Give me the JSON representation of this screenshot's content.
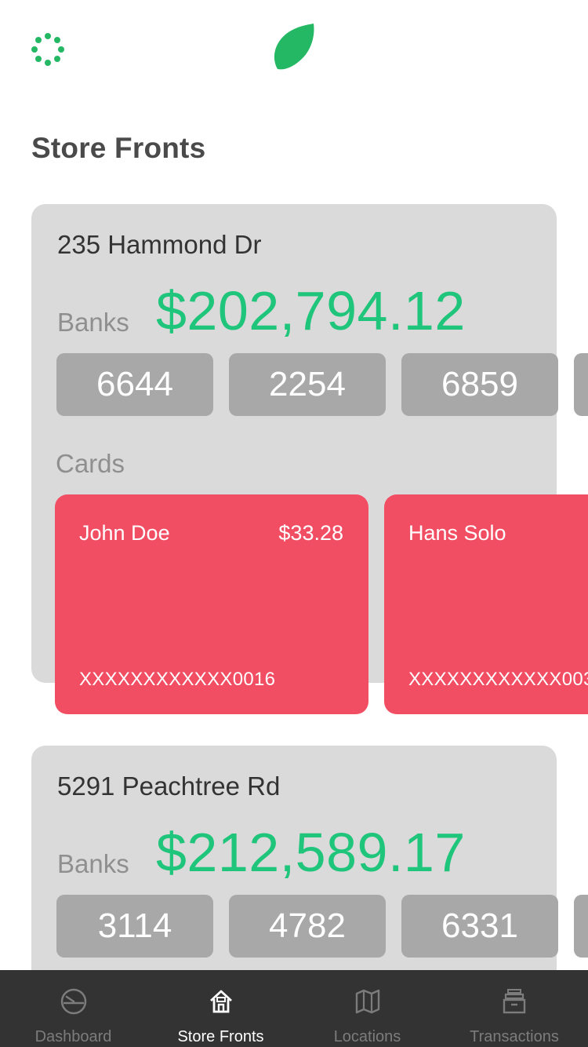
{
  "header": {
    "logo_icon": "leaf-icon",
    "spinner_icon": "loading-spinner-icon",
    "accent_color": "#25b864"
  },
  "page_title": "Store Fronts",
  "stores": [
    {
      "address": "235 Hammond Dr",
      "banks_label": "Banks",
      "total": "$202,794.12",
      "banks": [
        "6644",
        "2254",
        "6859"
      ],
      "cards_label": "Cards",
      "cards": [
        {
          "name": "John Doe",
          "amount": "$33.28",
          "number": "XXXXXXXXXXXX0016"
        },
        {
          "name": "Hans Solo",
          "amount": "",
          "number": "XXXXXXXXXXXX003"
        }
      ]
    },
    {
      "address": "5291 Peachtree Rd",
      "banks_label": "Banks",
      "total": "$212,589.17",
      "banks": [
        "3114",
        "4782",
        "6331"
      ]
    }
  ],
  "tabs": [
    {
      "label": "Dashboard",
      "icon": "dashboard-gauge-icon",
      "active": false
    },
    {
      "label": "Store Fronts",
      "icon": "store-house-icon",
      "active": true
    },
    {
      "label": "Locations",
      "icon": "map-icon",
      "active": false
    },
    {
      "label": "Transactions",
      "icon": "archive-box-icon",
      "active": false
    }
  ],
  "colors": {
    "amount_green": "#1fc57a",
    "card_red": "#f24e63",
    "chip_gray": "#a8a8a8",
    "store_bg": "#dadada",
    "tab_bar_bg": "#333333"
  }
}
